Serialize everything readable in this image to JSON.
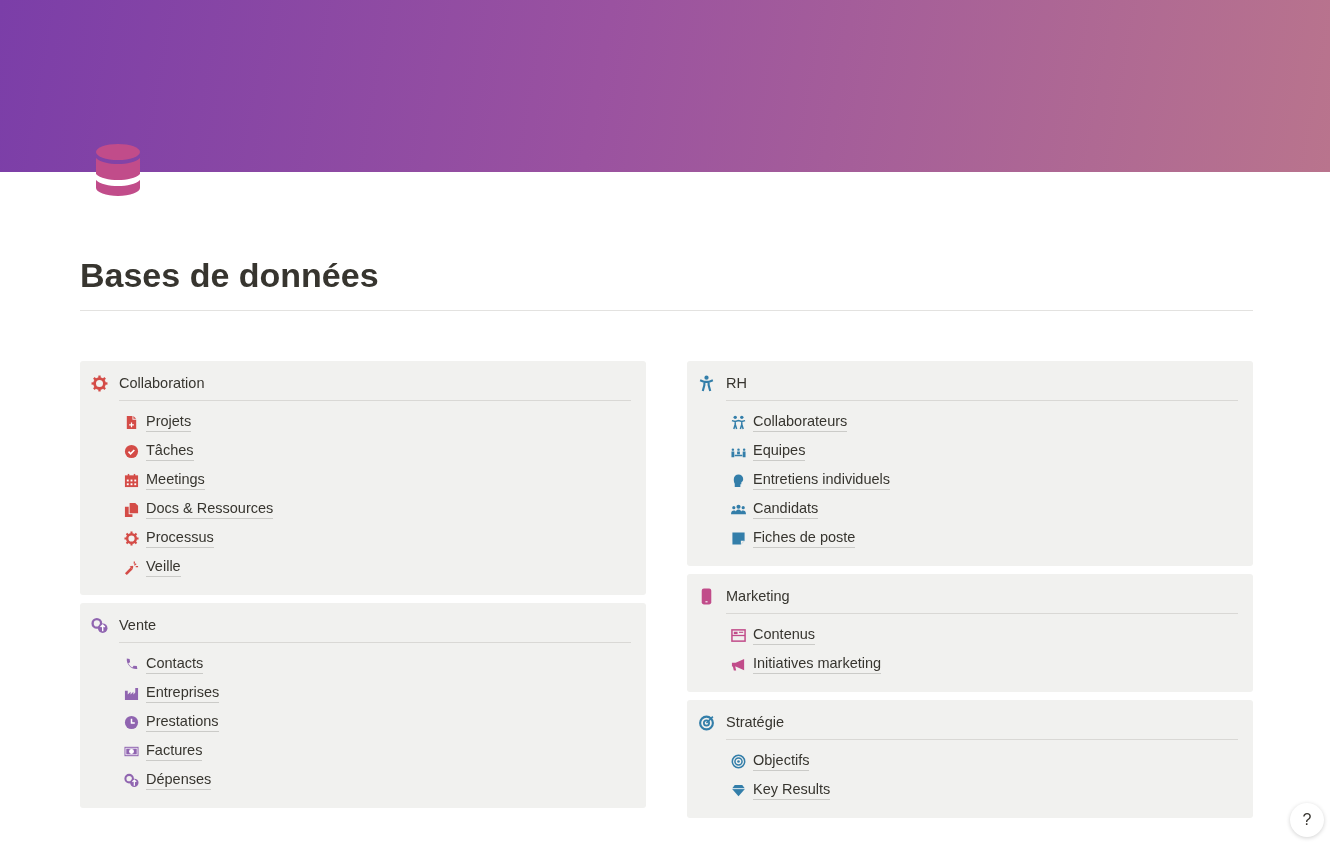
{
  "page": {
    "title": "Bases de données"
  },
  "columns": [
    {
      "sections": [
        {
          "title": "Collaboration",
          "color": "#d44c47",
          "items": [
            "Projets",
            "Tâches",
            "Meetings",
            "Docs & Ressources",
            "Processus",
            "Veille"
          ]
        },
        {
          "title": "Vente",
          "color": "#9065b0",
          "items": [
            "Contacts",
            "Entreprises",
            "Prestations",
            "Factures",
            "Dépenses"
          ]
        }
      ]
    },
    {
      "sections": [
        {
          "title": "RH",
          "color": "#337ea9",
          "items": [
            "Collaborateurs",
            "Equipes",
            "Entretiens individuels",
            "Candidats",
            "Fiches de poste"
          ]
        },
        {
          "title": "Marketing",
          "color": "#c14c8a",
          "items": [
            "Contenus",
            "Initiatives marketing"
          ]
        },
        {
          "title": "Stratégie",
          "color": "#337ea9",
          "items": [
            "Objectifs",
            "Key Results"
          ]
        }
      ]
    }
  ],
  "help_button": {
    "label": "?"
  }
}
